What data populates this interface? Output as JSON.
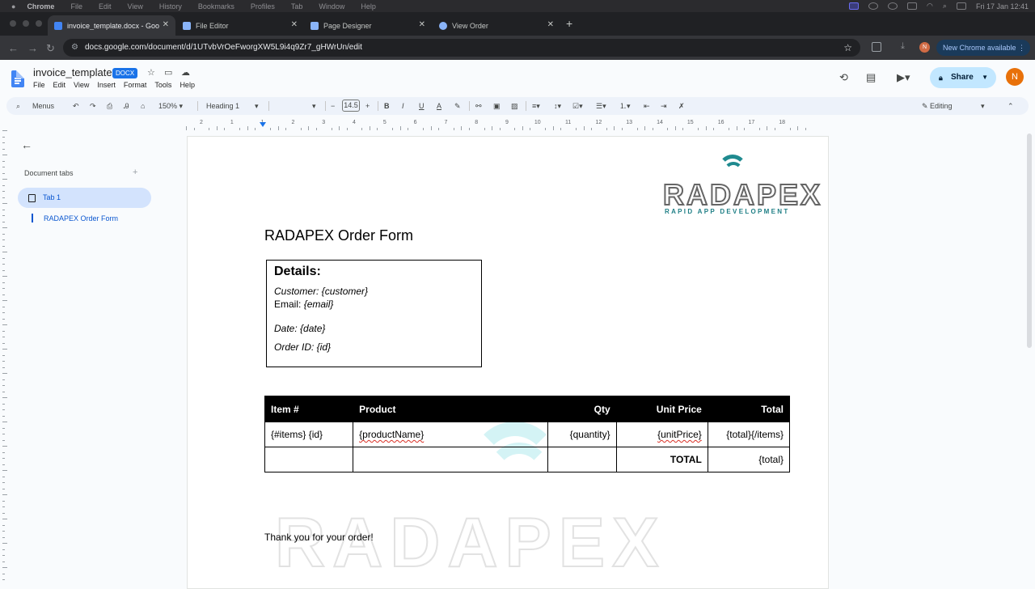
{
  "macbar": {
    "app": "Chrome",
    "menus": [
      "File",
      "Edit",
      "View",
      "History",
      "Bookmarks",
      "Profiles",
      "Tab",
      "Window",
      "Help"
    ],
    "clock": "Fri 17 Jan  12:41"
  },
  "tabs": [
    {
      "title": "invoice_template.docx - Goo",
      "icon": "google-docs-icon",
      "color": "#4285f4"
    },
    {
      "title": "File Editor",
      "icon": "wavemaker-icon",
      "color": "#8ab4f8"
    },
    {
      "title": "Page Designer",
      "icon": "wavemaker-icon",
      "color": "#8ab4f8"
    },
    {
      "title": "View Order",
      "icon": "globe-icon",
      "color": "#8ab4f8"
    }
  ],
  "address": {
    "url": "docs.google.com/document/d/1UTvbVrOeFworgXW5L9i4q9Zr7_gHWrUn/edit",
    "profile_initial": "N",
    "new_chrome": "New Chrome available"
  },
  "docs": {
    "title": "invoice_template",
    "badge": "DOCX",
    "menus": [
      "File",
      "Edit",
      "View",
      "Insert",
      "Format",
      "Tools",
      "Help"
    ],
    "share": "Share",
    "avatar": "N"
  },
  "toolbar": {
    "menus": "Menus",
    "zoom": "150%",
    "style": "Heading 1",
    "font_size": "14.5",
    "mode": "Editing"
  },
  "ruler": {
    "numbers": [
      "2",
      "1",
      "1",
      "2",
      "3",
      "4",
      "5",
      "6",
      "7",
      "8",
      "9",
      "10",
      "11",
      "12",
      "13",
      "14",
      "15",
      "16",
      "17",
      "18"
    ]
  },
  "sidebar": {
    "heading": "Document tabs",
    "tab_label": "Tab 1",
    "outline_item": "RADAPEX Order Form"
  },
  "document": {
    "logo_main": "RADAPEX",
    "logo_sub": "RAPID APP DEVELOPMENT",
    "watermark": "RADAPEX",
    "title": "RADAPEX Order Form",
    "details": {
      "heading": "Details:",
      "customer": "Customer: {customer}",
      "email_label": "Email: ",
      "email_value": "{email}",
      "date": "Date: {date}",
      "order_id": "Order ID: {id}"
    },
    "table": {
      "headers": [
        "Item #",
        "Product",
        "Qty",
        "Unit Price",
        "Total"
      ],
      "row": [
        "{#items} {id}",
        "{productName}",
        "{quantity}",
        "{unitPrice}",
        "{total}{/items}"
      ],
      "total_label": "TOTAL",
      "total_value": "{total}"
    },
    "thanks": "Thank you for your order!"
  },
  "colors": {
    "accent": "#0b57d0",
    "share_bg": "#c2e7ff",
    "brand_teal": "#1f8a8f",
    "avatar": "#e8710a"
  }
}
